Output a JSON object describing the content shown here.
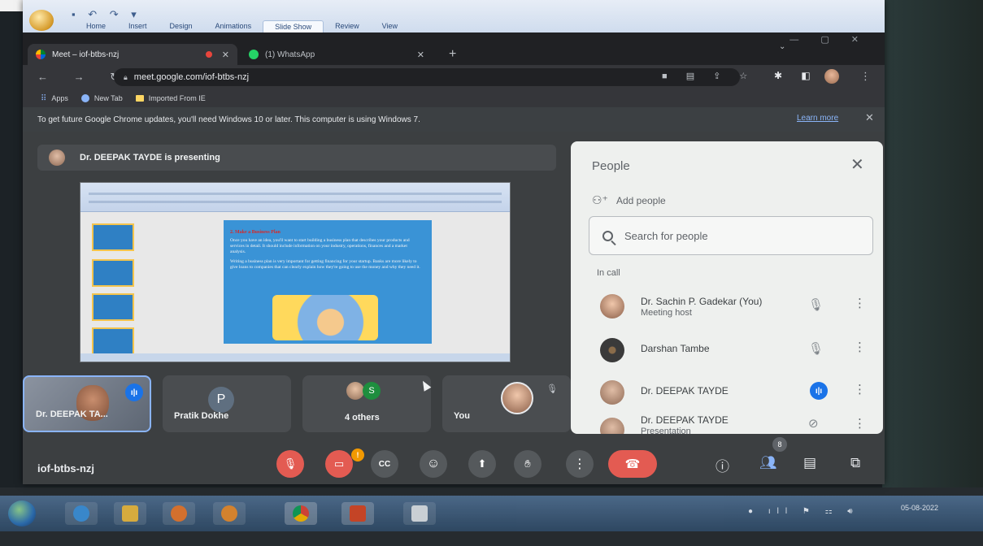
{
  "ppt": {
    "tabs": [
      "Home",
      "Insert",
      "Design",
      "Animations",
      "Slide Show",
      "Review",
      "View"
    ],
    "active_tab": "Slide Show"
  },
  "browser": {
    "tabs": [
      {
        "title": "Meet – iof-btbs-nzj",
        "active": true
      },
      {
        "title": "(1) WhatsApp",
        "active": false
      }
    ],
    "url": "meet.google.com/iof-btbs-nzj",
    "bookmarks": [
      "Apps",
      "New Tab",
      "Imported From IE"
    ],
    "infobar_text": "To get future Google Chrome updates, you'll need Windows 10 or later. This computer is using Windows 7.",
    "infobar_link": "Learn more"
  },
  "meet": {
    "presenter_banner": "Dr. DEEPAK TAYDE is presenting",
    "meeting_code": "iof-btbs-nzj",
    "tiles": [
      {
        "name": "Dr. DEEPAK TA..."
      },
      {
        "name": "Pratik Dokhe",
        "initial": "P"
      },
      {
        "name": "4 others",
        "initial": "S"
      },
      {
        "name": "You"
      }
    ],
    "people_count": "8",
    "warning_badge": "!"
  },
  "slide": {
    "title": "2. Make a Business Plan",
    "paragraph1": "Once you have an idea, you'll want to start building a business plan that describes your products and services in detail. It should include information on your industry, operations, finances and a market analysis.",
    "paragraph2": "Writing a business plan is very important for getting financing for your startup. Banks are more likely to give loans to companies that can clearly explain how they're going to use the money and why they need it."
  },
  "panel": {
    "title": "People",
    "add_people": "Add people",
    "search_placeholder": "Search for people",
    "section_label": "In call",
    "participants": [
      {
        "name": "Dr. Sachin P. Gadekar (You)",
        "subtitle": "Meeting host"
      },
      {
        "name": "Darshan Tambe",
        "subtitle": ""
      },
      {
        "name": "Dr. DEEPAK TAYDE",
        "subtitle": ""
      },
      {
        "name": "Dr. DEEPAK TAYDE",
        "subtitle": "Presentation"
      }
    ]
  },
  "taskbar": {
    "clock_date": "05-08-2022"
  }
}
